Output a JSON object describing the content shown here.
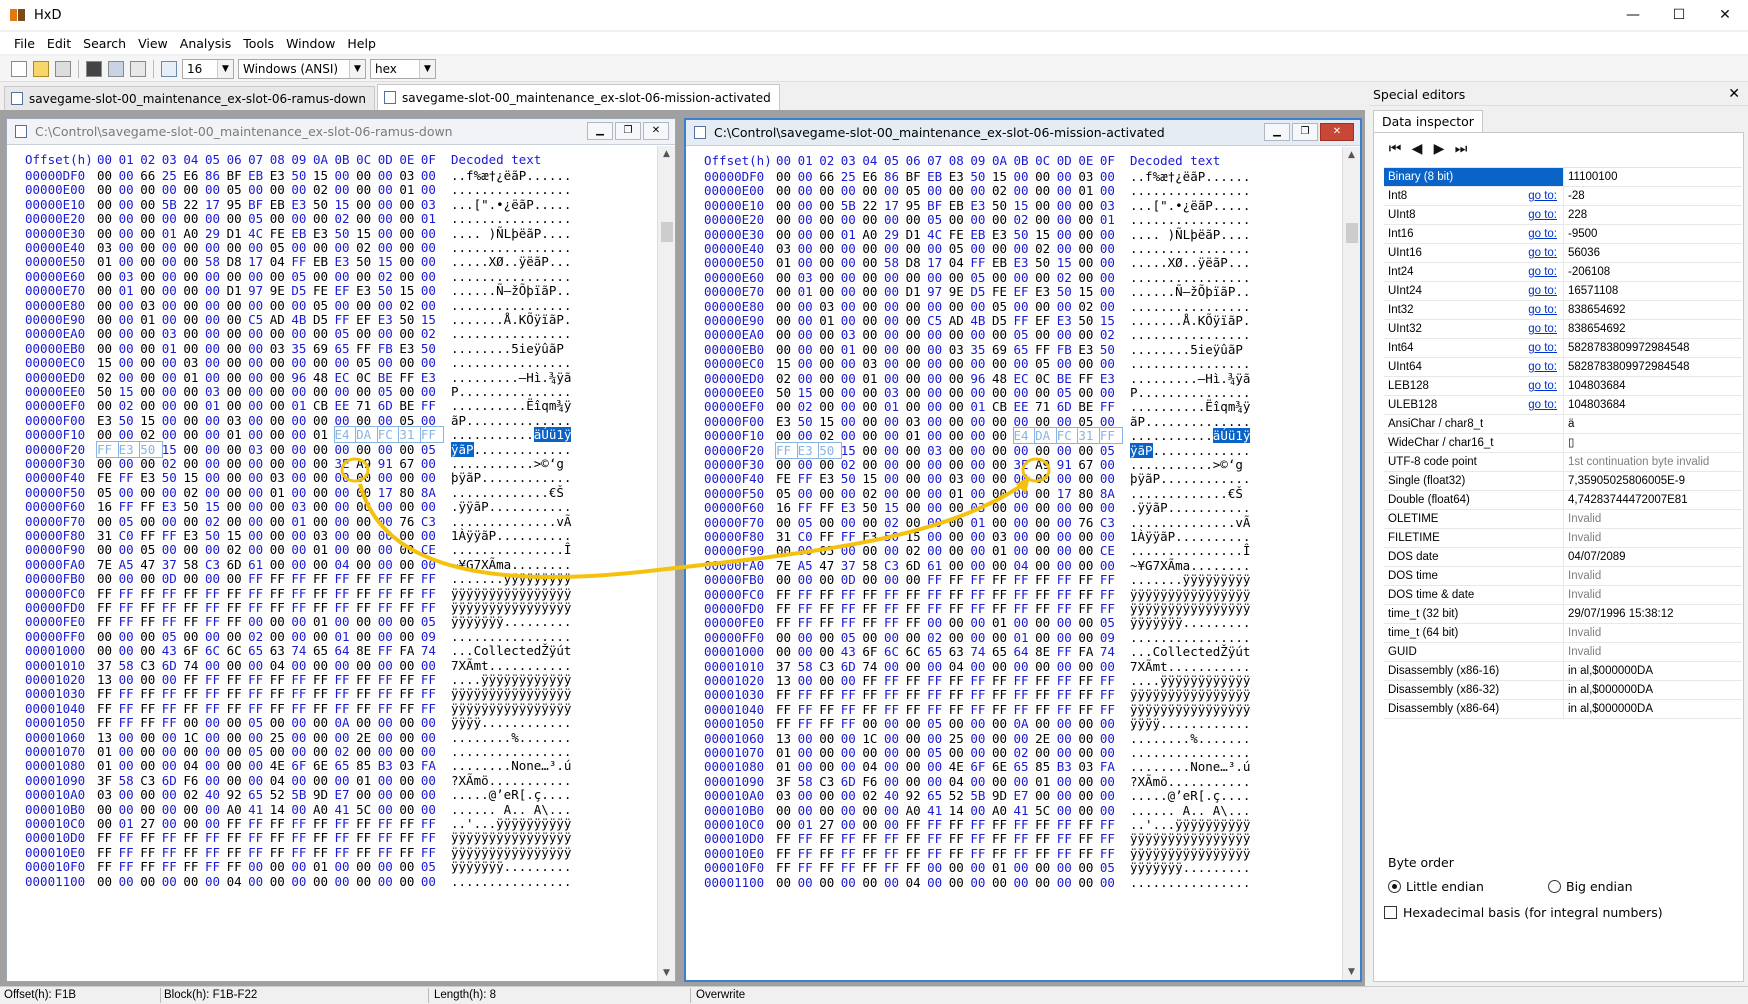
{
  "window": {
    "title": "HxD",
    "minimize": "—",
    "maximize": "☐",
    "close": "✕"
  },
  "menu": [
    "File",
    "Edit",
    "Search",
    "View",
    "Analysis",
    "Tools",
    "Window",
    "Help"
  ],
  "toolbar": {
    "bytes_per_row": "16",
    "charset": "Windows (ANSI)",
    "display": "hex"
  },
  "tabs": [
    "savegame-slot-00_maintenance_ex-slot-06-ramus-down",
    "savegame-slot-00_maintenance_ex-slot-06-mission-activated"
  ],
  "editor1": {
    "title": "C:\\Control\\savegame-slot-00_maintenance_ex-slot-06-ramus-down",
    "mark_byte": "01"
  },
  "editor2": {
    "title": "C:\\Control\\savegame-slot-00_maintenance_ex-slot-06-mission-activated",
    "mark_byte": "00"
  },
  "hex_header": {
    "offset": "Offset(h)",
    "cols": [
      "00",
      "01",
      "02",
      "03",
      "04",
      "05",
      "06",
      "07",
      "08",
      "09",
      "0A",
      "0B",
      "0C",
      "0D",
      "0E",
      "0F"
    ],
    "decoded": "Decoded text"
  },
  "rows": [
    {
      "o": "00000DF0",
      "b": "00 00 66 25 E6 86 BF EB E3 50 15 00 00 00 03 00",
      "t": "..f%æ†¿ëãP......"
    },
    {
      "o": "00000E00",
      "b": "00 00 00 00 00 00 05 00 00 00 02 00 00 00 01 00",
      "t": "................"
    },
    {
      "o": "00000E10",
      "b": "00 00 00 5B 22 17 95 BF EB E3 50 15 00 00 00 03",
      "t": "...[\".•¿ëãP....."
    },
    {
      "o": "00000E20",
      "b": "00 00 00 00 00 00 00 05 00 00 00 02 00 00 00 01",
      "t": "................"
    },
    {
      "o": "00000E30",
      "b": "00 00 00 01 A0 29 D1 4C FE EB E3 50 15 00 00 00",
      "t": ".... )ÑLþëãP...."
    },
    {
      "o": "00000E40",
      "b": "03 00 00 00 00 00 00 00 05 00 00 00 02 00 00 00",
      "t": "................"
    },
    {
      "o": "00000E50",
      "b": "01 00 00 00 00 58 D8 17 04 FF EB E3 50 15 00 00",
      "t": ".....XØ..ÿëãP..."
    },
    {
      "o": "00000E60",
      "b": "00 03 00 00 00 00 00 00 00 05 00 00 00 02 00 00",
      "t": "................"
    },
    {
      "o": "00000E70",
      "b": "00 01 00 00 00 00 D1 97 9E D5 FE EF E3 50 15 00",
      "t": "......Ñ—žÕþïãP.."
    },
    {
      "o": "00000E80",
      "b": "00 00 03 00 00 00 00 00 00 00 05 00 00 00 02 00",
      "t": "................"
    },
    {
      "o": "00000E90",
      "b": "00 00 01 00 00 00 00 C5 AD 4B D5 FF EF E3 50 15",
      "t": ".......Å.KÕÿïãP."
    },
    {
      "o": "00000EA0",
      "b": "00 00 00 03 00 00 00 00 00 00 00 05 00 00 00 02",
      "t": "................"
    },
    {
      "o": "00000EB0",
      "b": "00 00 00 01 00 00 00 00 03 35 69 65 FF FB E3 50",
      "t": "........5ieÿûãP"
    },
    {
      "o": "00000EC0",
      "b": "15 00 00 00 03 00 00 00 00 00 00 00 05 00 00 00",
      "t": "................"
    },
    {
      "o": "00000ED0",
      "b": "02 00 00 00 01 00 00 00 00 96 48 EC 0C BE FF E3",
      "t": ".........–Hì.¾ÿã"
    },
    {
      "o": "00000EE0",
      "b": "50 15 00 00 00 03 00 00 00 00 00 00 00 05 00 00",
      "t": "P..............."
    },
    {
      "o": "00000EF0",
      "b": "00 02 00 00 00 01 00 00 00 01 CB EE 71 6D BE FF",
      "t": "..........Ëîqm¾ÿ"
    },
    {
      "o": "00000F00",
      "b": "E3 50 15 00 00 00 03 00 00 00 00 00 00 00 05 00",
      "t": "ãP.............."
    },
    {
      "o": "00000F10",
      "b": "00 00 02 00 00 00 01 00 00 00 ?? E4 DA FC 31 FF",
      "t": "...........äÚü1ÿ",
      "sel_from": 11,
      "sel_t": 11
    },
    {
      "o": "00000F20",
      "b": "FF E3 50 15 00 00 00 03 00 00 00 00 00 00 00 05",
      "t": "ÿãP.............",
      "sel_to": 2,
      "sel_t_to": 3
    },
    {
      "o": "00000F30",
      "b": "00 00 00 02 00 00 00 00 00 00 00 3E A9 91 67 00",
      "t": "...........>©‘g"
    },
    {
      "o": "00000F40",
      "b": "FE FF E3 50 15 00 00 00 03 00 00 00 00 00 00 00",
      "t": "þÿãP............"
    },
    {
      "o": "00000F50",
      "b": "05 00 00 00 02 00 00 00 01 00 00 00 00 17 80 8A",
      "t": ".............€Š"
    },
    {
      "o": "00000F60",
      "b": "16 FF FF E3 50 15 00 00 00 03 00 00 00 00 00 00",
      "t": ".ÿÿãP..........."
    },
    {
      "o": "00000F70",
      "b": "00 05 00 00 00 02 00 00 00 01 00 00 00 00 76 C3",
      "t": "..............vÃ"
    },
    {
      "o": "00000F80",
      "b": "31 C0 FF FF E3 50 15 00 00 00 03 00 00 00 00 00",
      "t": "1ÀÿÿãP.........."
    },
    {
      "o": "00000F90",
      "b": "00 00 05 00 00 00 02 00 00 00 01 00 00 00 00 CE",
      "t": "...............Î"
    },
    {
      "o": "00000FA0",
      "b": "7E A5 47 37 58 C3 6D 61 00 00 00 04 00 00 00 00",
      "t": "~¥G7XÃma........"
    },
    {
      "o": "00000FB0",
      "b": "00 00 00 0D 00 00 00 FF FF FF FF FF FF FF FF FF",
      "t": ".......ÿÿÿÿÿÿÿÿÿ"
    },
    {
      "o": "00000FC0",
      "b": "FF FF FF FF FF FF FF FF FF FF FF FF FF FF FF FF",
      "t": "ÿÿÿÿÿÿÿÿÿÿÿÿÿÿÿÿ"
    },
    {
      "o": "00000FD0",
      "b": "FF FF FF FF FF FF FF FF FF FF FF FF FF FF FF FF",
      "t": "ÿÿÿÿÿÿÿÿÿÿÿÿÿÿÿÿ"
    },
    {
      "o": "00000FE0",
      "b": "FF FF FF FF FF FF FF 00 00 00 01 00 00 00 00 05",
      "t": "ÿÿÿÿÿÿÿ........."
    },
    {
      "o": "00000FF0",
      "b": "00 00 00 05 00 00 00 02 00 00 00 01 00 00 00 09",
      "t": "................"
    },
    {
      "o": "00001000",
      "b": "00 00 00 43 6F 6C 6C 65 63 74 65 64 8E FF FA 74",
      "t": "...CollectedŽÿút"
    },
    {
      "o": "00001010",
      "b": "37 58 C3 6D 74 00 00 00 04 00 00 00 00 00 00 00",
      "t": "7XÃmt..........."
    },
    {
      "o": "00001020",
      "b": "13 00 00 00 FF FF FF FF FF FF FF FF FF FF FF FF",
      "t": "....ÿÿÿÿÿÿÿÿÿÿÿÿ"
    },
    {
      "o": "00001030",
      "b": "FF FF FF FF FF FF FF FF FF FF FF FF FF FF FF FF",
      "t": "ÿÿÿÿÿÿÿÿÿÿÿÿÿÿÿÿ"
    },
    {
      "o": "00001040",
      "b": "FF FF FF FF FF FF FF FF FF FF FF FF FF FF FF FF",
      "t": "ÿÿÿÿÿÿÿÿÿÿÿÿÿÿÿÿ"
    },
    {
      "o": "00001050",
      "b": "FF FF FF FF 00 00 00 05 00 00 00 0A 00 00 00 00",
      "t": "ÿÿÿÿ............"
    },
    {
      "o": "00001060",
      "b": "13 00 00 00 1C 00 00 00 25 00 00 00 2E 00 00 00",
      "t": "........%......."
    },
    {
      "o": "00001070",
      "b": "01 00 00 00 00 00 00 05 00 00 00 02 00 00 00 00",
      "t": "................"
    },
    {
      "o": "00001080",
      "b": "01 00 00 00 04 00 00 00 4E 6F 6E 65 85 B3 03 FA",
      "t": "........None…³.ú"
    },
    {
      "o": "00001090",
      "b": "3F 58 C3 6D F6 00 00 00 04 00 00 00 01 00 00 00",
      "t": "?XÃmö..........."
    },
    {
      "o": "000010A0",
      "b": "03 00 00 00 02 40 92 65 52 5B 9D E7 00 00 00 00",
      "t": ".....@’eR[.ç...."
    },
    {
      "o": "000010B0",
      "b": "00 00 00 00 00 00 A0 41 14 00 A0 41 5C 00 00 00",
      "t": "...... A.. A\\..."
    },
    {
      "o": "000010C0",
      "b": "00 01 27 00 00 00 FF FF FF FF FF FF FF FF FF FF",
      "t": "..'...ÿÿÿÿÿÿÿÿÿÿ"
    },
    {
      "o": "000010D0",
      "b": "FF FF FF FF FF FF FF FF FF FF FF FF FF FF FF FF",
      "t": "ÿÿÿÿÿÿÿÿÿÿÿÿÿÿÿÿ"
    },
    {
      "o": "000010E0",
      "b": "FF FF FF FF FF FF FF FF FF FF FF FF FF FF FF FF",
      "t": "ÿÿÿÿÿÿÿÿÿÿÿÿÿÿÿÿ"
    },
    {
      "o": "000010F0",
      "b": "FF FF FF FF FF FF FF 00 00 00 01 00 00 00 00 05",
      "t": "ÿÿÿÿÿÿÿ........."
    },
    {
      "o": "00001100",
      "b": "00 00 00 00 00 00 04 00 00 00 00 00 00 00 00 00",
      "t": "................"
    }
  ],
  "special_editors": {
    "header": "Special editors",
    "close": "✕",
    "tab": "Data inspector",
    "nav": [
      "⏮",
      "◀",
      "▶",
      "⏭"
    ],
    "go_to": "go to:",
    "rows": [
      {
        "name": "Binary (8 bit)",
        "value": "11100100",
        "sel": true
      },
      {
        "name": "Int8",
        "value": "-28",
        "go": true
      },
      {
        "name": "UInt8",
        "value": "228",
        "go": true
      },
      {
        "name": "Int16",
        "value": "-9500",
        "go": true
      },
      {
        "name": "UInt16",
        "value": "56036",
        "go": true
      },
      {
        "name": "Int24",
        "value": "-206108",
        "go": true
      },
      {
        "name": "UInt24",
        "value": "16571108",
        "go": true
      },
      {
        "name": "Int32",
        "value": "838654692",
        "go": true
      },
      {
        "name": "UInt32",
        "value": "838654692",
        "go": true
      },
      {
        "name": "Int64",
        "value": "5828783809972984548",
        "go": true
      },
      {
        "name": "UInt64",
        "value": "5828783809972984548",
        "go": true
      },
      {
        "name": "LEB128",
        "value": "104803684",
        "go": true
      },
      {
        "name": "ULEB128",
        "value": "104803684",
        "go": true
      },
      {
        "name": "AnsiChar / char8_t",
        "value": "ä"
      },
      {
        "name": "WideChar / char16_t",
        "value": "▯"
      },
      {
        "name": "UTF-8 code point",
        "value": "1st continuation byte invalid",
        "inv": true
      },
      {
        "name": "Single (float32)",
        "value": "7,35905025806005E-9"
      },
      {
        "name": "Double (float64)",
        "value": "4,74283744472007E81"
      },
      {
        "name": "OLETIME",
        "value": "Invalid",
        "inv": true
      },
      {
        "name": "FILETIME",
        "value": "Invalid",
        "inv": true
      },
      {
        "name": "DOS date",
        "value": "04/07/2089"
      },
      {
        "name": "DOS time",
        "value": "Invalid",
        "inv": true
      },
      {
        "name": "DOS time & date",
        "value": "Invalid",
        "inv": true
      },
      {
        "name": "time_t (32 bit)",
        "value": "29/07/1996 15:38:12"
      },
      {
        "name": "time_t (64 bit)",
        "value": "Invalid",
        "inv": true
      },
      {
        "name": "GUID",
        "value": "Invalid",
        "inv": true
      },
      {
        "name": "Disassembly (x86-16)",
        "value": "in al,$000000DA"
      },
      {
        "name": "Disassembly (x86-32)",
        "value": "in al,$000000DA"
      },
      {
        "name": "Disassembly (x86-64)",
        "value": "in al,$000000DA"
      }
    ],
    "byte_order_label": "Byte order",
    "little_endian": "Little endian",
    "big_endian": "Big endian",
    "hex_basis": "Hexadecimal basis (for integral numbers)"
  },
  "status": {
    "offset": "Offset(h): F1B",
    "block": "Block(h): F1B-F22",
    "length": "Length(h): 8",
    "mode": "Overwrite"
  },
  "colors": {
    "selection": "#0a64c8",
    "annotation": "#f4c20d",
    "offset_text": "#1a1ad4"
  }
}
